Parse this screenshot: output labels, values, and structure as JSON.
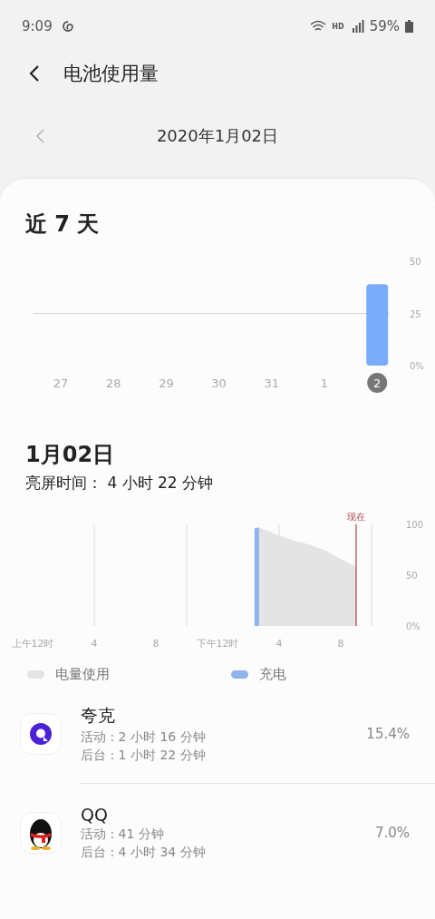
{
  "status_bar": {
    "time": "9:09",
    "network": "HD",
    "battery": "59%"
  },
  "header": {
    "title": "电池使用量"
  },
  "date_nav": {
    "date": "2020年1月02日"
  },
  "week": {
    "title": "近 7 天",
    "days": [
      {
        "selected": false
      },
      {
        "selected": false
      },
      {
        "selected": false
      },
      {
        "selected": false
      },
      {
        "selected": false
      },
      {
        "selected": false
      },
      {
        "selected": true
      }
    ],
    "chart_data": {
      "type": "bar",
      "categories": [
        "27",
        "28",
        "29",
        "30",
        "31",
        "1",
        "2"
      ],
      "values": [
        0,
        0,
        0,
        0,
        0,
        0,
        39
      ],
      "color": "#7aacfa",
      "ylim": [
        0,
        50
      ],
      "yticks": [
        {
          "value": 0,
          "label": "0%"
        },
        25,
        50
      ]
    }
  },
  "day": {
    "title": "1月02日",
    "afternoon_hour_labels": [
      "4",
      "8"
    ],
    "screen_time": "亮屏时间： 4 小时 22 分钟",
    "chart_data": {
      "type": "area",
      "x": [
        14.4,
        14.7,
        16,
        17,
        18,
        19,
        20,
        21
      ],
      "series": [
        {
          "name": "电量使用",
          "color": "#e4e4e4",
          "values": [
            null,
            97,
            89,
            84,
            80,
            74,
            66,
            58
          ]
        },
        {
          "name": "充电",
          "color": "#8fb3ec",
          "values": [
            96,
            97,
            null,
            null,
            null,
            null,
            null,
            null
          ]
        }
      ],
      "xlim": [
        0,
        22
      ],
      "ylim": [
        0,
        100
      ],
      "xticks": [
        {
          "value": 0,
          "label": "上午12时"
        },
        {
          "value": 4,
          "label": "4"
        },
        {
          "value": 8,
          "label": "8"
        },
        {
          "value": 12,
          "label": "下午12时"
        }
      ],
      "yticks": [
        {
          "value": 0,
          "label": "0%"
        },
        50,
        100
      ],
      "ref_lines": [
        {
          "axis": "x",
          "value": 21,
          "label": "现在",
          "color": "#a8404c"
        }
      ]
    }
  },
  "apps": [
    {
      "name": "夸克",
      "kind": "quark",
      "active": "活动 : 2 小时 16 分钟",
      "background": "后台 : 1 小时 22 分钟",
      "percent": "15.4%"
    },
    {
      "name": "QQ",
      "kind": "qq",
      "active": "活动 : 41 分钟",
      "background": "后台 : 4 小时 34 分钟",
      "percent": "7.0%"
    }
  ]
}
